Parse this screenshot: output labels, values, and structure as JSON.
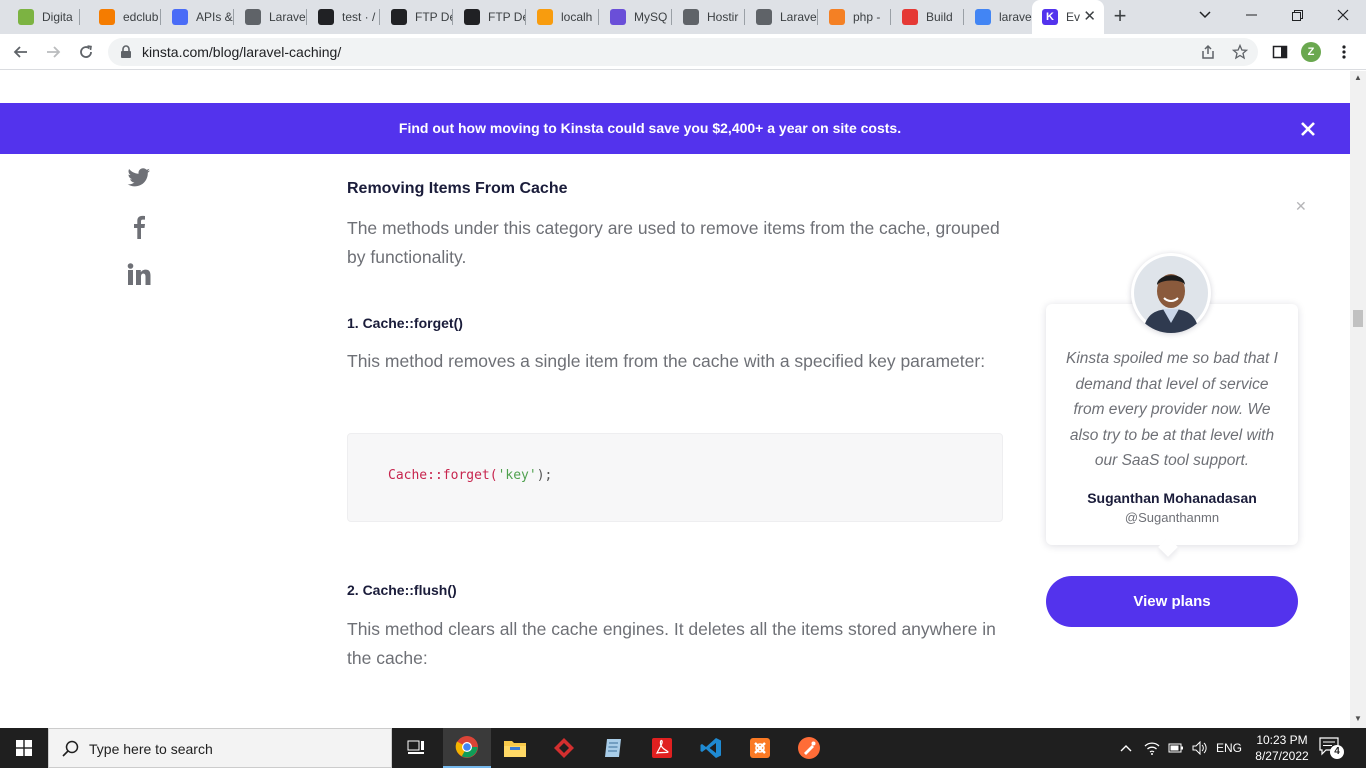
{
  "browser": {
    "tabs": [
      {
        "label": "Digita",
        "icon": "puzzle-icon",
        "color": "#7cb342"
      },
      {
        "label": "edclub",
        "icon": "edclub-icon",
        "color": "#f57c00"
      },
      {
        "label": "APIs &",
        "icon": "api-icon",
        "color": "#4a6cf7"
      },
      {
        "label": "Larave",
        "icon": "globe-icon",
        "color": "#5f6368"
      },
      {
        "label": "test · /",
        "icon": "github-icon",
        "color": "#202124"
      },
      {
        "label": "FTP De",
        "icon": "github-icon",
        "color": "#202124"
      },
      {
        "label": "FTP De",
        "icon": "github-icon",
        "color": "#202124"
      },
      {
        "label": "localh",
        "icon": "phpmyadmin-icon",
        "color": "#f89c0e"
      },
      {
        "label": "MySQ",
        "icon": "mysql-icon",
        "color": "#6a4fd8"
      },
      {
        "label": "Hostir",
        "icon": "globe-icon",
        "color": "#5f6368"
      },
      {
        "label": "Larave",
        "icon": "globe-icon",
        "color": "#5f6368"
      },
      {
        "label": "php -",
        "icon": "stackoverflow-icon",
        "color": "#f48024"
      },
      {
        "label": "Build",
        "icon": "build-icon",
        "color": "#e53935"
      },
      {
        "label": "larave",
        "icon": "google-icon",
        "color": "#4285f4"
      },
      {
        "label": "Ev",
        "icon": "kinsta-icon",
        "color": "#5333ed",
        "active": true
      }
    ],
    "url": "kinsta.com/blog/laravel-caching/",
    "profile_initial": "Z"
  },
  "banner": {
    "text": "Find out how moving to Kinsta could save you $2,400+ a year on site costs."
  },
  "article": {
    "section_heading": "Removing Items From Cache",
    "section_intro": "The methods under this category are used to remove items from the cache, grouped by functionality.",
    "method1": {
      "heading": "1. Cache::forget()",
      "description": "This method removes a single item from the cache with a specified key parameter:",
      "code_fn": "Cache::forget(",
      "code_arg": "'key'",
      "code_end": ");"
    },
    "method2": {
      "heading": "2. Cache::flush()",
      "description": "This method clears all the cache engines. It deletes all the items stored anywhere in the cache:"
    }
  },
  "testimonial": {
    "quote": "Kinsta spoiled me so bad that I demand that level of service from every provider now. We also try to be at that level with our SaaS tool support.",
    "author": "Suganthan Mohanadasan",
    "handle": "@Suganthanmn",
    "cta_label": "View plans"
  },
  "taskbar": {
    "search_placeholder": "Type here to search",
    "language": "ENG",
    "time": "10:23 PM",
    "date": "8/27/2022",
    "notification_count": "4"
  },
  "colors": {
    "brand": "#5333ed",
    "heading": "#1a1c3a",
    "body_text": "#6e7076"
  }
}
